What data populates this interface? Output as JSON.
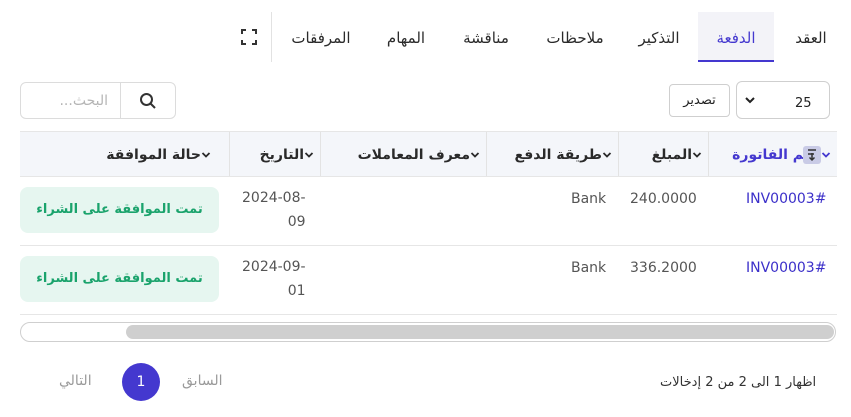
{
  "tabs": [
    {
      "label": "العقد",
      "active": false
    },
    {
      "label": "الدفعة",
      "active": true
    },
    {
      "label": "التذكير",
      "active": false
    },
    {
      "label": "ملاحظات",
      "active": false
    },
    {
      "label": "مناقشة",
      "active": false
    },
    {
      "label": "المهام",
      "active": false
    },
    {
      "label": "المرفقات",
      "active": false
    }
  ],
  "toolbar": {
    "search_placeholder": "البحث...",
    "export_label": "تصدير",
    "page_size": "25"
  },
  "table": {
    "columns": [
      "رقم الفاتورة",
      "المبلغ",
      "طريقة الدفع",
      "معرف المعاملات",
      "التاريخ",
      "حالة الموافقة"
    ],
    "rows": [
      {
        "invoice": "INV00003#",
        "amount": "240.0000",
        "method": "Bank",
        "transaction_id": "",
        "date_line1": "2024-08-",
        "date_line2": "09",
        "status": "تمت الموافقة على الشراء"
      },
      {
        "invoice": "INV00003#",
        "amount": "336.2000",
        "method": "Bank",
        "transaction_id": "",
        "date_line1": "2024-09-",
        "date_line2": "01",
        "status": "تمت الموافقة على الشراء"
      }
    ]
  },
  "footer": {
    "entries_info": "اظهار 1 الى 2 من 2 إدخالات",
    "prev_label": "السابق",
    "current_page": "1",
    "next_label": "التالي"
  },
  "colors": {
    "accent": "#4438cf",
    "status_bg": "#e6f6f0",
    "status_text": "#1aa36c",
    "header_bg": "#f4f6fa"
  }
}
